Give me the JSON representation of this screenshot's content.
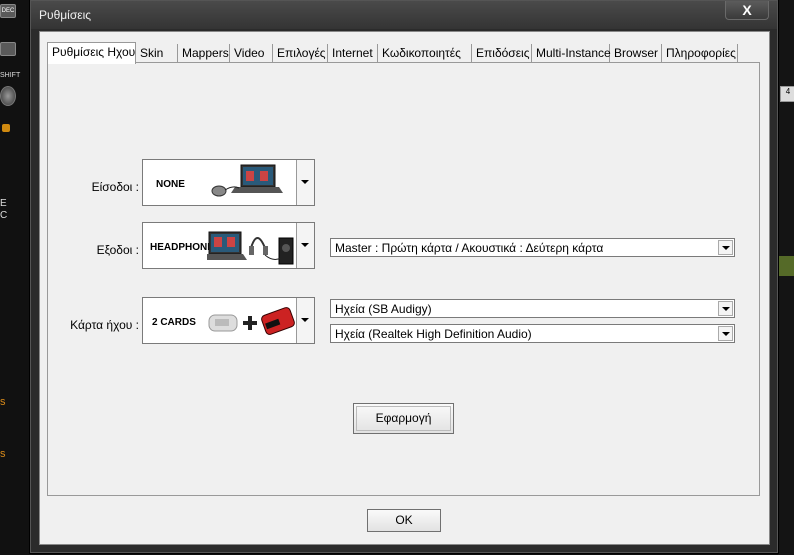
{
  "window": {
    "title": "Ρυθμίσεις",
    "close_label": "X"
  },
  "background": {
    "btn1": "DEC",
    "btn2": "SHIFT",
    "right_btn": "4",
    "left_char_1": "E",
    "left_char_2": "C",
    "left_char_3": "s",
    "left_char_4": "s"
  },
  "tabs": [
    {
      "label": "Ρυθμίσεις Ηχου",
      "active": true
    },
    {
      "label": "Skin"
    },
    {
      "label": "Mappers"
    },
    {
      "label": "Video"
    },
    {
      "label": "Επιλογές"
    },
    {
      "label": "Internet"
    },
    {
      "label": "Κωδικοποιητές"
    },
    {
      "label": "Επιδόσεις"
    },
    {
      "label": "Multi-Instance"
    },
    {
      "label": "Browser"
    },
    {
      "label": "Πληροφορίες"
    }
  ],
  "audio": {
    "inputs_label": "Είσοδοι :",
    "inputs_value": "NONE",
    "outputs_label": "Εξοδοι :",
    "outputs_value": "HEADPHONES",
    "outputs_mode": "Master : Πρώτη κάρτα / Ακουστικά : Δεύτερη κάρτα",
    "card_label": "Κάρτα ήχου :",
    "card_value": "2 CARDS",
    "card_1": "Ηχεία (SB Audigy)",
    "card_2": "Ηχεία (Realtek High Definition Audio)",
    "apply_label": "Εφαρμογή"
  },
  "ok_label": "OK"
}
